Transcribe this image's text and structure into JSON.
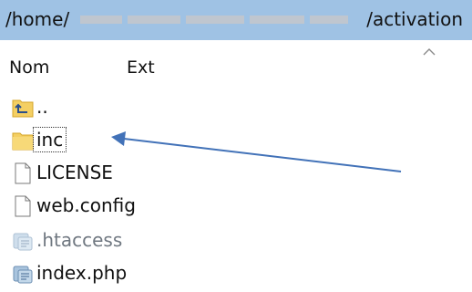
{
  "path": {
    "prefix": "/home/",
    "suffix": "/activation"
  },
  "columns": {
    "name": "Nom",
    "ext": "Ext"
  },
  "files": [
    {
      "name": "..",
      "icon": "parent-folder-icon"
    },
    {
      "name": "inc",
      "icon": "folder-icon",
      "focused": true
    },
    {
      "name": "LICENSE",
      "icon": "file-icon"
    },
    {
      "name": "web.config",
      "icon": "file-icon"
    },
    {
      "name": ".htaccess",
      "icon": "script-file-icon",
      "hidden": true
    },
    {
      "name": "index.php",
      "icon": "script-file-icon"
    }
  ],
  "colors": {
    "path_bar": "#9fc2e4",
    "folder": "#f4cf63",
    "annotation_arrow": "#4272b8",
    "hidden_text": "#6f7780"
  }
}
